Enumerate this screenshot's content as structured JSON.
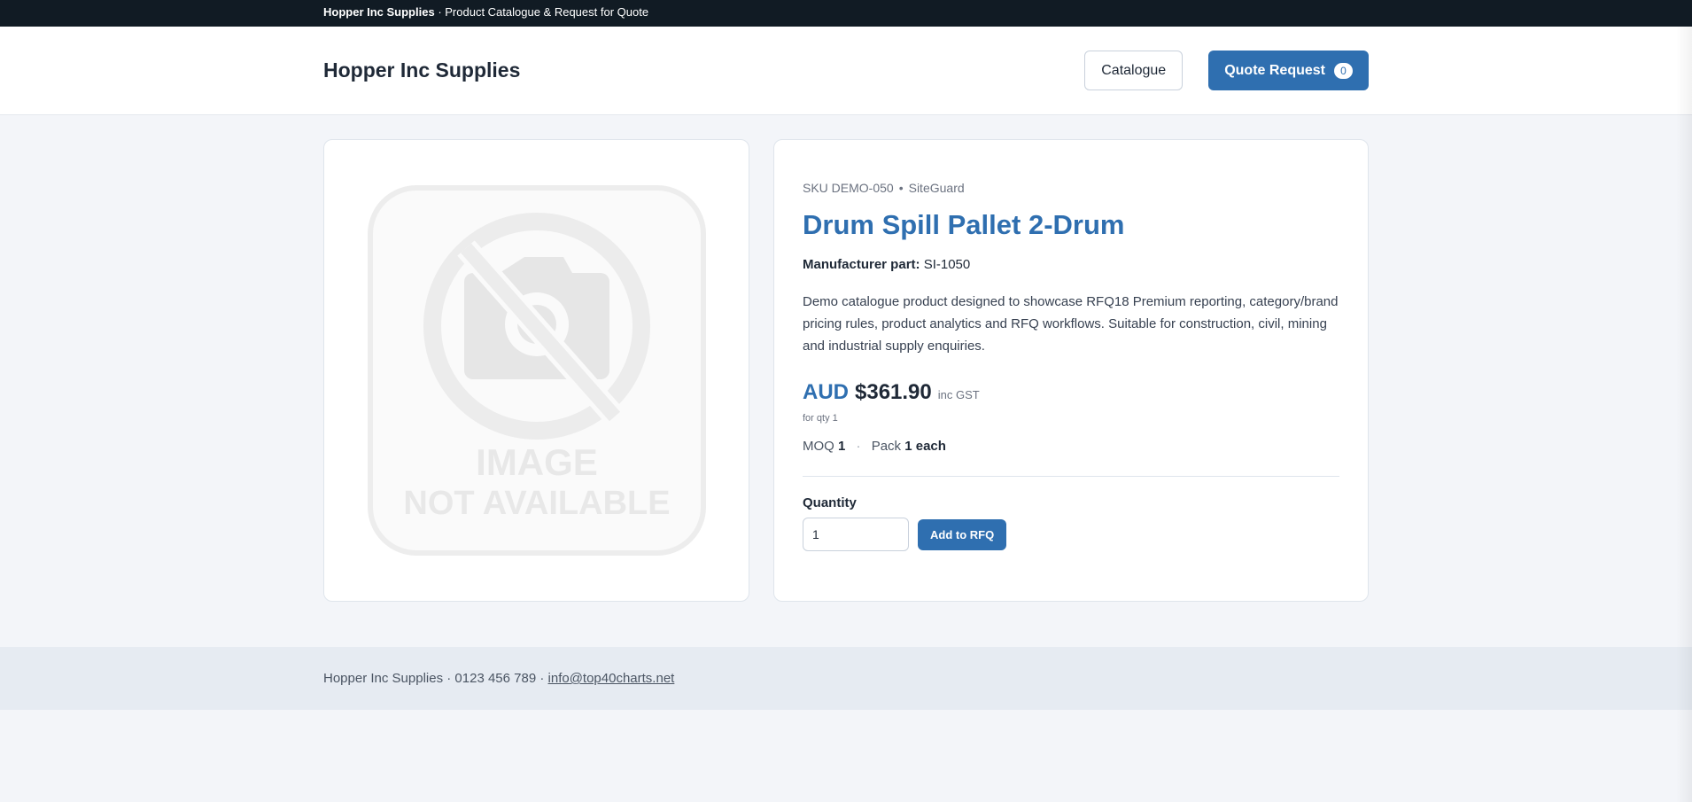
{
  "topbar": {
    "brand": "Hopper Inc Supplies",
    "tagline": "· Product Catalogue & Request for Quote"
  },
  "header": {
    "brand": "Hopper Inc Supplies",
    "catalogue_label": "Catalogue",
    "quote_label": "Quote Request",
    "quote_count": "0"
  },
  "product": {
    "sku": "SKU DEMO-050",
    "separator": "•",
    "brand": "SiteGuard",
    "title": "Drum Spill Pallet 2-Drum",
    "manufacturer_label": "Manufacturer part:",
    "manufacturer_part": "SI-1050",
    "description": "Demo catalogue product designed to showcase RFQ18 Premium reporting, category/brand pricing rules, product analytics and RFQ workflows. Suitable for construction, civil, mining and industrial supply enquiries.",
    "currency": "AUD",
    "price": "$361.90",
    "tax_label": "inc GST",
    "qty_note": "for qty 1",
    "moq_label": "MOQ",
    "moq_value": "1",
    "moq_sep": "·",
    "pack_label": "Pack",
    "pack_value": "1 each"
  },
  "image_placeholder": {
    "line1": "IMAGE",
    "line2": "NOT AVAILABLE"
  },
  "quantity": {
    "label": "Quantity",
    "value": "1",
    "add_label": "Add to RFQ"
  },
  "footer": {
    "text": "Hopper Inc Supplies · 0123 456 789 ·",
    "email": "info@top40charts.net"
  },
  "colors": {
    "accent": "#2f6fb0",
    "topbar": "#111b24",
    "background": "#f3f5f9"
  }
}
